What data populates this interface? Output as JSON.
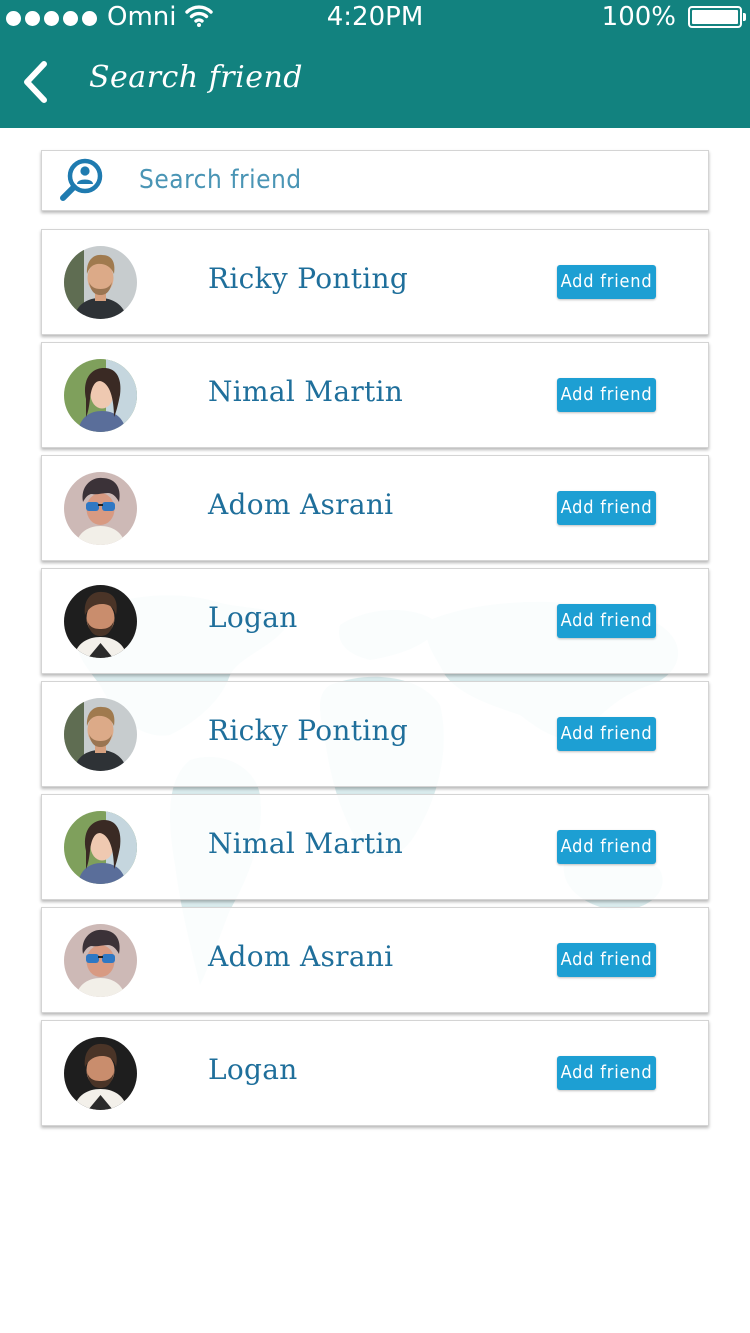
{
  "status_bar": {
    "carrier": "Omni",
    "time": "4:20PM",
    "battery": "100%"
  },
  "header": {
    "title": "Search friend",
    "back_icon": "chevron-left-icon"
  },
  "search": {
    "placeholder": "Search friend",
    "icon": "search-user-icon"
  },
  "friends": [
    {
      "name": "Ricky Ponting",
      "button": "Add friend",
      "avatar": "man-beard-blond"
    },
    {
      "name": "Nimal Martin",
      "button": "Add friend",
      "avatar": "woman-dark-hair"
    },
    {
      "name": "Adom Asrani",
      "button": "Add friend",
      "avatar": "man-sunglasses"
    },
    {
      "name": "Logan",
      "button": "Add friend",
      "avatar": "man-beard-dark"
    },
    {
      "name": "Ricky Ponting",
      "button": "Add friend",
      "avatar": "man-beard-blond"
    },
    {
      "name": "Nimal Martin",
      "button": "Add friend",
      "avatar": "woman-dark-hair"
    },
    {
      "name": "Adom Asrani",
      "button": "Add friend",
      "avatar": "man-sunglasses"
    },
    {
      "name": "Logan",
      "button": "Add friend",
      "avatar": "man-beard-dark"
    }
  ],
  "colors": {
    "header": "#12827f",
    "accent": "#1d9fd3",
    "name_text": "#1f6f9b",
    "placeholder": "#4a95b5"
  }
}
